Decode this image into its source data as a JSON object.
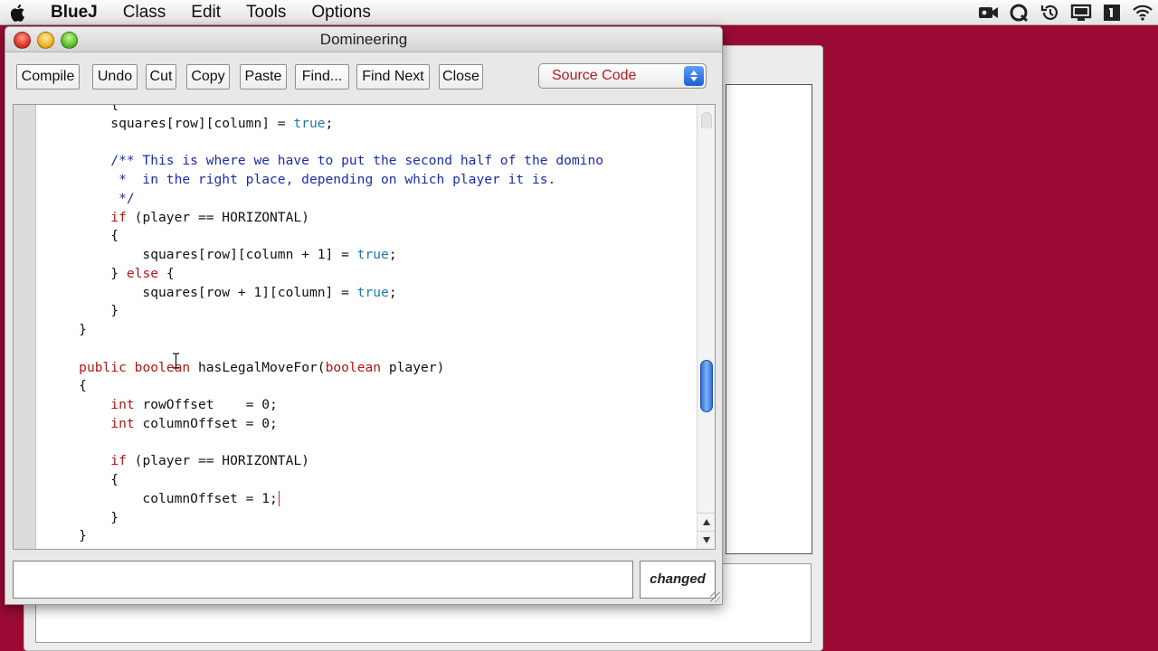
{
  "menubar": {
    "app_name": "BlueJ",
    "menus": [
      "Class",
      "Edit",
      "Tools",
      "Options"
    ],
    "status_icons": [
      "video-icon",
      "quicksilver-icon",
      "time-machine-icon",
      "display-icon",
      "one-password-icon",
      "wifi-icon"
    ]
  },
  "window": {
    "title": "Domineering"
  },
  "toolbar": {
    "compile_label": "Compile",
    "undo_label": "Undo",
    "cut_label": "Cut",
    "copy_label": "Copy",
    "paste_label": "Paste",
    "find_label": "Find...",
    "find_next_label": "Find Next",
    "close_label": "Close",
    "view_select_value": "Source Code"
  },
  "editor": {
    "lines": [
      [
        {
          "t": "        {",
          "c": ""
        }
      ],
      [
        {
          "t": "        squares[row][column] = ",
          "c": ""
        },
        {
          "t": "true",
          "c": "lit"
        },
        {
          "t": ";",
          "c": ""
        }
      ],
      [
        {
          "t": "",
          "c": ""
        }
      ],
      [
        {
          "t": "        /** This is where we have to put the second half of the domino",
          "c": "cmt"
        }
      ],
      [
        {
          "t": "         *  in the right place, depending on which player it is.",
          "c": "cmt"
        }
      ],
      [
        {
          "t": "         */",
          "c": "cmt"
        }
      ],
      [
        {
          "t": "        ",
          "c": ""
        },
        {
          "t": "if",
          "c": "kw"
        },
        {
          "t": " (player == HORIZONTAL)",
          "c": ""
        }
      ],
      [
        {
          "t": "        {",
          "c": ""
        }
      ],
      [
        {
          "t": "            squares[row][column + 1] = ",
          "c": ""
        },
        {
          "t": "true",
          "c": "lit"
        },
        {
          "t": ";",
          "c": ""
        }
      ],
      [
        {
          "t": "        } ",
          "c": ""
        },
        {
          "t": "else",
          "c": "kw"
        },
        {
          "t": " {",
          "c": ""
        }
      ],
      [
        {
          "t": "            squares[row + 1][column] = ",
          "c": ""
        },
        {
          "t": "true",
          "c": "lit"
        },
        {
          "t": ";",
          "c": ""
        }
      ],
      [
        {
          "t": "        }",
          "c": ""
        }
      ],
      [
        {
          "t": "    }",
          "c": ""
        }
      ],
      [
        {
          "t": "",
          "c": ""
        }
      ],
      [
        {
          "t": "    ",
          "c": ""
        },
        {
          "t": "public",
          "c": "kw"
        },
        {
          "t": " ",
          "c": ""
        },
        {
          "t": "boolean",
          "c": "kw"
        },
        {
          "t": " hasLegalMoveFor(",
          "c": ""
        },
        {
          "t": "boolean",
          "c": "kw"
        },
        {
          "t": " player)",
          "c": ""
        }
      ],
      [
        {
          "t": "    {",
          "c": ""
        }
      ],
      [
        {
          "t": "        ",
          "c": ""
        },
        {
          "t": "int",
          "c": "kw"
        },
        {
          "t": " rowOffset    = 0;",
          "c": ""
        }
      ],
      [
        {
          "t": "        ",
          "c": ""
        },
        {
          "t": "int",
          "c": "kw"
        },
        {
          "t": " columnOffset = 0;",
          "c": ""
        }
      ],
      [
        {
          "t": "",
          "c": ""
        }
      ],
      [
        {
          "t": "        ",
          "c": ""
        },
        {
          "t": "if",
          "c": "kw"
        },
        {
          "t": " (player == HORIZONTAL)",
          "c": ""
        }
      ],
      [
        {
          "t": "        {",
          "c": ""
        }
      ],
      [
        {
          "t": "            columnOffset = 1;",
          "c": "",
          "caret": true
        }
      ],
      [
        {
          "t": "        }",
          "c": ""
        }
      ],
      [
        {
          "t": "    }",
          "c": ""
        }
      ]
    ]
  },
  "status": {
    "message": "",
    "state_label": "changed"
  },
  "colors": {
    "desktop": "#9a0a34",
    "keyword": "#b01818",
    "literal": "#1c7ba8",
    "comment": "#1b2ea6",
    "select_text": "#b02020"
  }
}
